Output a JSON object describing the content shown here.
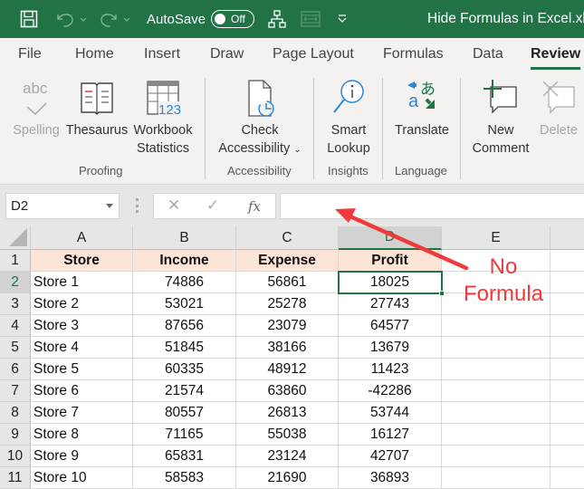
{
  "titlebar": {
    "autosave_label": "AutoSave",
    "autosave_state": "Off",
    "doc_title": "Hide Formulas in Excel.xlsx",
    "bg_color": "#217346"
  },
  "tabs": [
    {
      "label": "File"
    },
    {
      "label": "Home"
    },
    {
      "label": "Insert"
    },
    {
      "label": "Draw"
    },
    {
      "label": "Page Layout"
    },
    {
      "label": "Formulas"
    },
    {
      "label": "Data"
    },
    {
      "label": "Review",
      "active": true
    }
  ],
  "ribbon": {
    "spelling": "Spelling",
    "thesaurus": "Thesaurus",
    "workbook_statistics_1": "Workbook",
    "workbook_statistics_2": "Statistics",
    "check_accessibility_1": "Check",
    "check_accessibility_2": "Accessibility",
    "smart_lookup_1": "Smart",
    "smart_lookup_2": "Lookup",
    "translate": "Translate",
    "new_comment_1": "New",
    "new_comment_2": "Comment",
    "delete": "Delete",
    "groups": {
      "proofing": "Proofing",
      "accessibility": "Accessibility",
      "insights": "Insights",
      "language": "Language"
    },
    "icon_text_abc": "abc",
    "icon_text_123": "123"
  },
  "formula_bar": {
    "name_box": "D2",
    "cancel_icon": "✕",
    "enter_icon": "✓",
    "fx_label": "fx",
    "formula_value": ""
  },
  "sheet": {
    "columns": [
      "A",
      "B",
      "C",
      "D",
      "E"
    ],
    "selected_column": "D",
    "active_cell": "D2",
    "header_fill": "#fce4d6",
    "rows": [
      {
        "num": "1",
        "cells": [
          "Store",
          "Income",
          "Expense",
          "Profit"
        ]
      },
      {
        "num": "2",
        "cells": [
          "Store 1",
          "74886",
          "56861",
          "18025"
        ]
      },
      {
        "num": "3",
        "cells": [
          "Store 2",
          "53021",
          "25278",
          "27743"
        ]
      },
      {
        "num": "4",
        "cells": [
          "Store 3",
          "87656",
          "23079",
          "64577"
        ]
      },
      {
        "num": "5",
        "cells": [
          "Store 4",
          "51845",
          "38166",
          "13679"
        ]
      },
      {
        "num": "6",
        "cells": [
          "Store 5",
          "60335",
          "48912",
          "11423"
        ]
      },
      {
        "num": "7",
        "cells": [
          "Store 6",
          "21574",
          "63860",
          "-42286"
        ]
      },
      {
        "num": "8",
        "cells": [
          "Store 7",
          "80557",
          "26813",
          "53744"
        ]
      },
      {
        "num": "9",
        "cells": [
          "Store 8",
          "71165",
          "55038",
          "16127"
        ]
      },
      {
        "num": "10",
        "cells": [
          "Store 9",
          "65831",
          "23124",
          "42707"
        ]
      },
      {
        "num": "11",
        "cells": [
          "Store 10",
          "58583",
          "21690",
          "36893"
        ]
      }
    ]
  },
  "annotation": {
    "line1": "No",
    "line2": "Formula",
    "color": "#f0393b"
  }
}
